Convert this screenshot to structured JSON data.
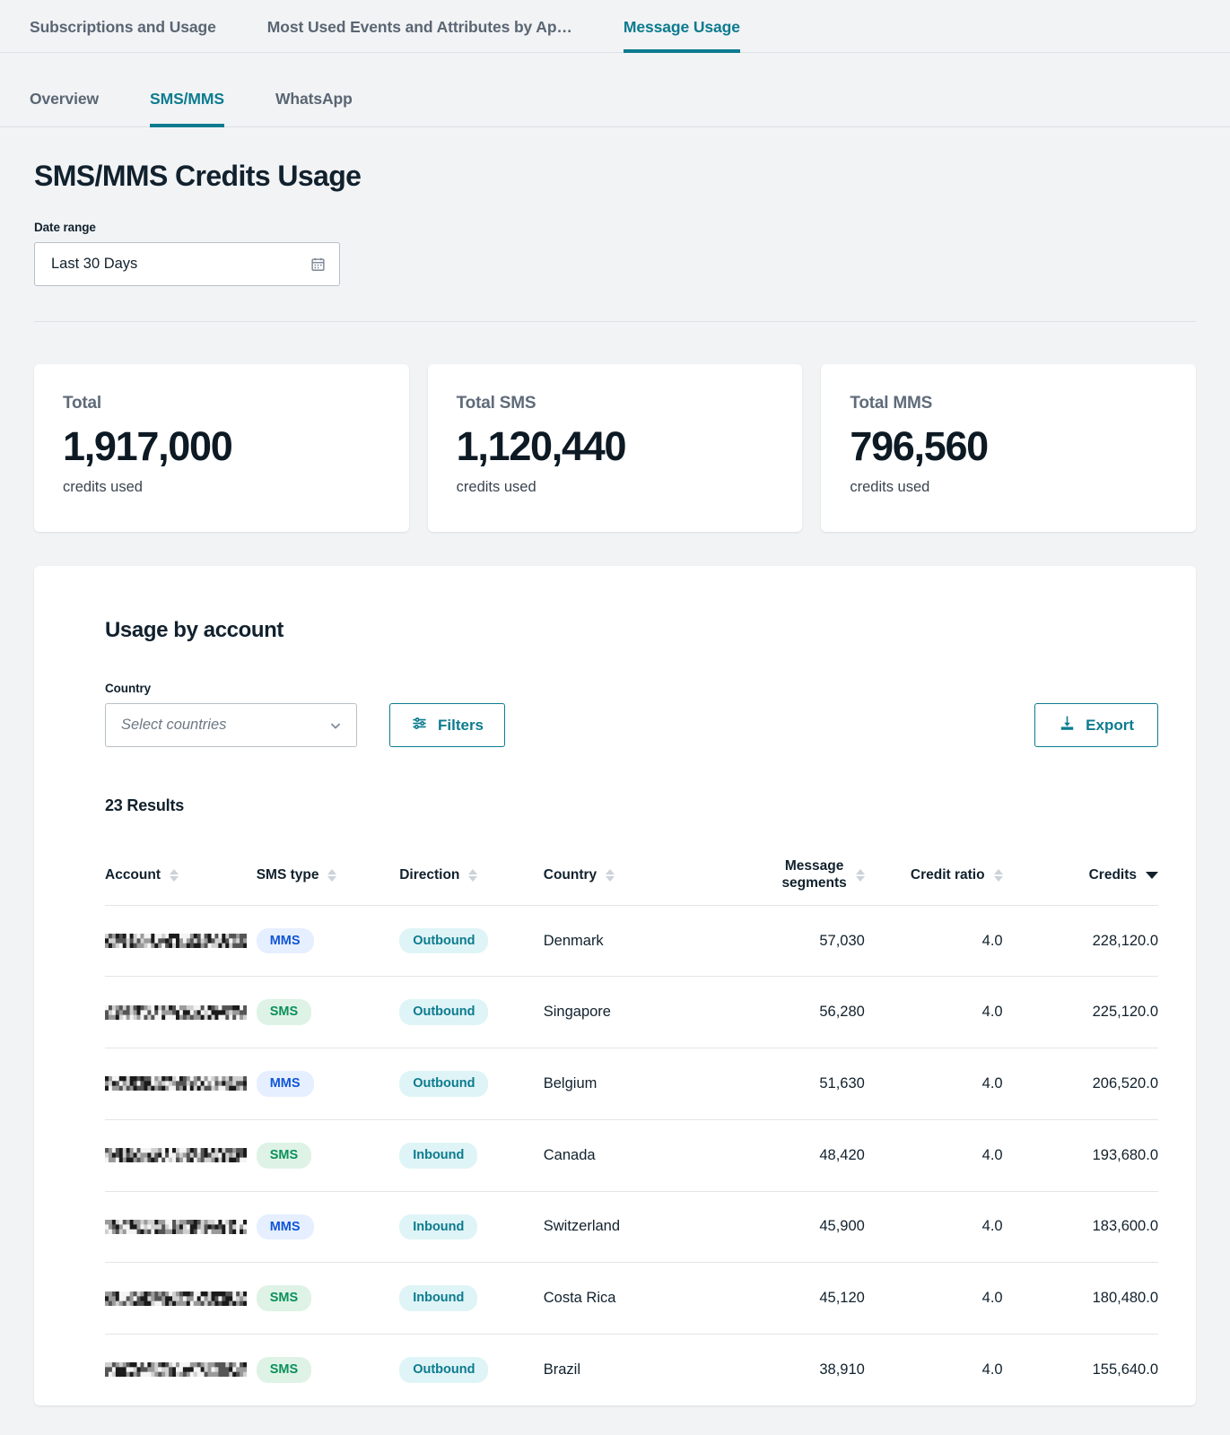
{
  "top_tabs": [
    {
      "label": "Subscriptions and Usage",
      "active": false
    },
    {
      "label": "Most Used Events and Attributes by Ap…",
      "active": false
    },
    {
      "label": "Message Usage",
      "active": true
    }
  ],
  "sub_tabs": [
    {
      "label": "Overview",
      "active": false
    },
    {
      "label": "SMS/MMS",
      "active": true
    },
    {
      "label": "WhatsApp",
      "active": false
    }
  ],
  "page": {
    "title": "SMS/MMS Credits Usage",
    "date_range_label": "Date range",
    "date_range_value": "Last 30 Days"
  },
  "stats": [
    {
      "label": "Total",
      "value": "1,917,000",
      "sub": "credits used"
    },
    {
      "label": "Total SMS",
      "value": "1,120,440",
      "sub": "credits used"
    },
    {
      "label": "Total MMS",
      "value": "796,560",
      "sub": "credits used"
    }
  ],
  "panel": {
    "title": "Usage by account",
    "country_label": "Country",
    "country_placeholder": "Select countries",
    "filters_label": "Filters",
    "export_label": "Export",
    "results_count": "23 Results"
  },
  "table": {
    "columns": [
      {
        "label": "Account",
        "sort": "none",
        "align": "left"
      },
      {
        "label": "SMS type",
        "sort": "none",
        "align": "left"
      },
      {
        "label": "Direction",
        "sort": "none",
        "align": "left"
      },
      {
        "label": "Country",
        "sort": "none",
        "align": "left"
      },
      {
        "label": "Message segments",
        "sort": "none",
        "align": "right"
      },
      {
        "label": "Credit ratio",
        "sort": "none",
        "align": "right"
      },
      {
        "label": "Credits",
        "sort": "desc",
        "align": "right"
      }
    ],
    "rows": [
      {
        "account": "█░█▒█░█",
        "sms_type": "MMS",
        "direction": "Outbound",
        "country": "Denmark",
        "segments": "57,030",
        "ratio": "4.0",
        "credits": "228,120.0"
      },
      {
        "account": "█░█▒█░█",
        "sms_type": "SMS",
        "direction": "Outbound",
        "country": "Singapore",
        "segments": "56,280",
        "ratio": "4.0",
        "credits": "225,120.0"
      },
      {
        "account": "█░█▒█░█",
        "sms_type": "MMS",
        "direction": "Outbound",
        "country": "Belgium",
        "segments": "51,630",
        "ratio": "4.0",
        "credits": "206,520.0"
      },
      {
        "account": "█░█▒█░█",
        "sms_type": "SMS",
        "direction": "Inbound",
        "country": "Canada",
        "segments": "48,420",
        "ratio": "4.0",
        "credits": "193,680.0"
      },
      {
        "account": "█░█▒█░█",
        "sms_type": "MMS",
        "direction": "Inbound",
        "country": "Switzerland",
        "segments": "45,900",
        "ratio": "4.0",
        "credits": "183,600.0"
      },
      {
        "account": "█░█▒█░█",
        "sms_type": "SMS",
        "direction": "Inbound",
        "country": "Costa Rica",
        "segments": "45,120",
        "ratio": "4.0",
        "credits": "180,480.0"
      },
      {
        "account": "█░█▒█░█",
        "sms_type": "SMS",
        "direction": "Outbound",
        "country": "Brazil",
        "segments": "38,910",
        "ratio": "4.0",
        "credits": "155,640.0"
      }
    ]
  },
  "icons": {
    "calendar": "calendar-icon",
    "chevron_down": "chevron-down-icon",
    "filters": "filters-sliders-icon",
    "export": "download-icon",
    "sort": "sort-arrows-icon"
  },
  "colors": {
    "accent_teal": "#0c7b8f",
    "page_bg": "#f2f3f5",
    "card_bg": "#ffffff",
    "text_primary": "#11212d",
    "text_muted": "#5f6b7a",
    "badge_mms_bg": "#e6efff",
    "badge_mms_fg": "#1155d6",
    "badge_sms_bg": "#def3e6",
    "badge_sms_fg": "#0c8f5a",
    "badge_dir_bg": "#dff4f6",
    "badge_dir_fg": "#0c7b8f"
  }
}
